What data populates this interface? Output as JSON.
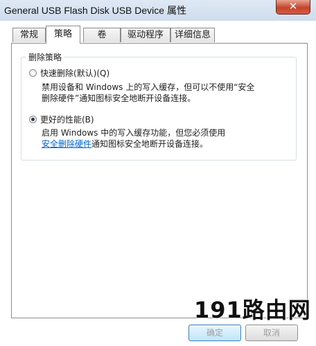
{
  "window": {
    "title": "General USB Flash Disk USB Device 属性",
    "close_glyph": "✕"
  },
  "tabs": [
    {
      "label": "常规",
      "active": false
    },
    {
      "label": "策略",
      "active": true
    },
    {
      "label": "卷",
      "active": false
    },
    {
      "label": "驱动程序",
      "active": false
    },
    {
      "label": "详细信息",
      "active": false
    }
  ],
  "policy": {
    "group_title": "删除策略",
    "options": [
      {
        "label": "快速删除(默认)(Q)",
        "checked": false,
        "description_line1": "禁用设备和 Windows 上的写入缓存，但可以不使用“安全",
        "description_line2": "删除硬件”通知图标安全地断开设备连接。"
      },
      {
        "label": "更好的性能(B)",
        "checked": true,
        "description_line1": "启用 Windows 中的写入缓存功能，但您必须使用",
        "link_text": "安全删除硬件",
        "description_line2_rest": "通知图标安全地断开设备连接。"
      }
    ]
  },
  "buttons": {
    "ok": "确定",
    "cancel": "取消"
  },
  "watermark": {
    "text": "191路由网"
  },
  "colors": {
    "link": "#0066cc",
    "titlebar": "#dfe9f5",
    "close_button": "#c5442b"
  }
}
